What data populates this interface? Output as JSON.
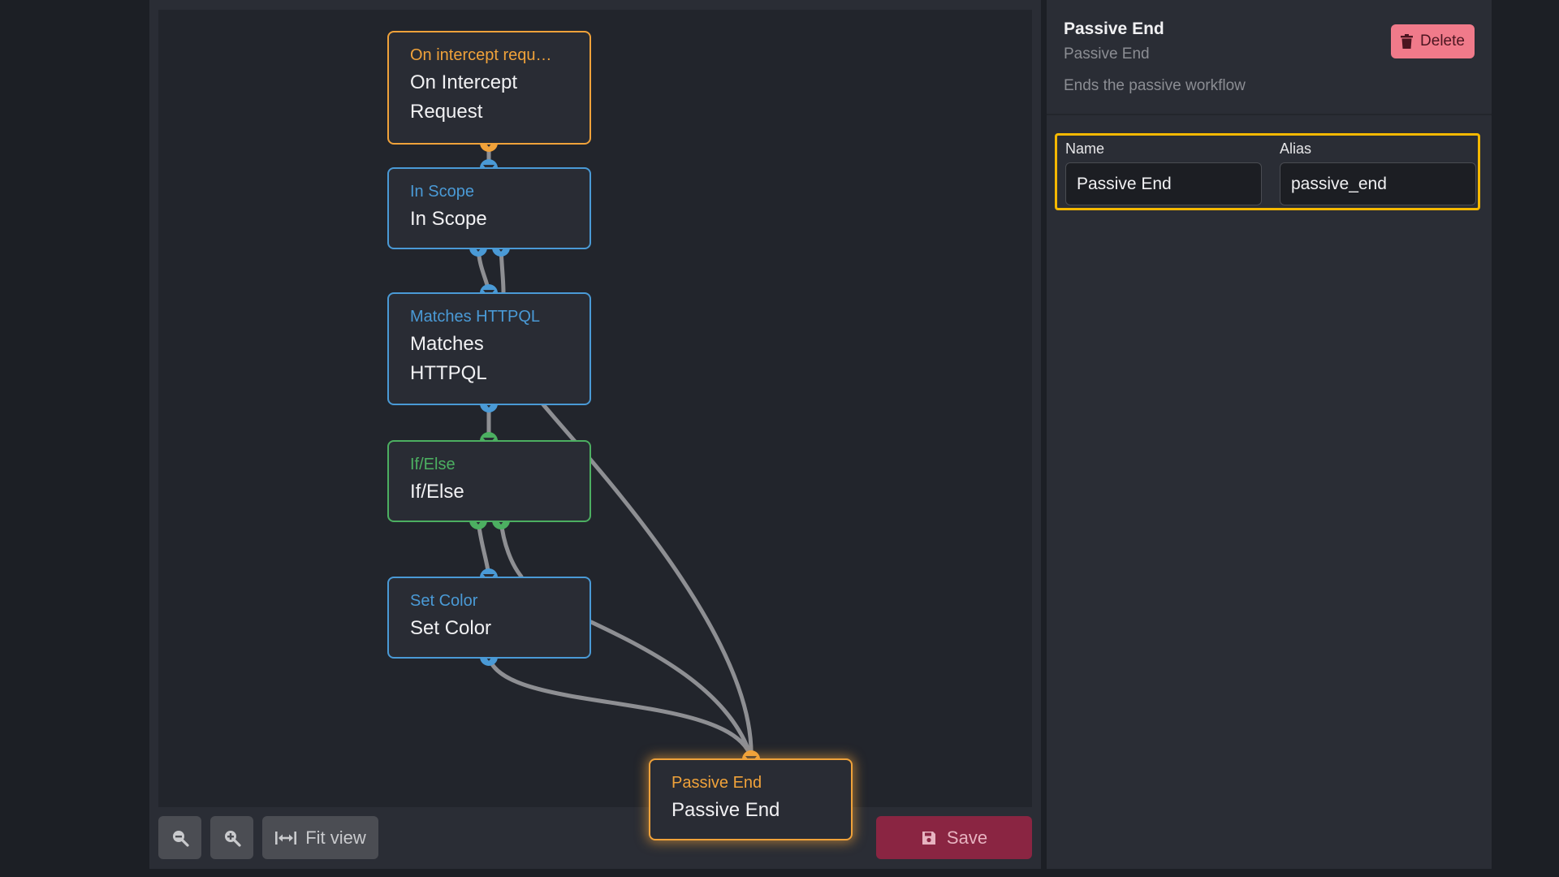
{
  "canvas": {
    "nodes": [
      {
        "id": "on_intercept",
        "type_label": "On intercept requ…",
        "name": "On Intercept Request",
        "color": "#f0a23a"
      },
      {
        "id": "in_scope",
        "type_label": "In Scope",
        "name": "In Scope",
        "color": "#4a9ad6"
      },
      {
        "id": "matches_httpql",
        "type_label": "Matches HTTPQL",
        "name": "Matches HTTPQL",
        "color": "#4a9ad6"
      },
      {
        "id": "if_else",
        "type_label": "If/Else",
        "name": "If/Else",
        "color": "#4caf61"
      },
      {
        "id": "set_color",
        "type_label": "Set Color",
        "name": "Set Color",
        "color": "#4a9ad6"
      },
      {
        "id": "passive_end",
        "type_label": "Passive End",
        "name": "Passive End",
        "color": "#f0a23a",
        "selected": true
      }
    ],
    "edge_color": "#8e8f93"
  },
  "toolbar": {
    "zoom_out_icon": "zoom-out-icon",
    "zoom_in_icon": "zoom-in-icon",
    "fit_view_label": "Fit view",
    "save_label": "Save"
  },
  "inspector": {
    "title": "Passive End",
    "subtitle": "Passive End",
    "description": "Ends the passive workflow",
    "delete_label": "Delete",
    "fields": {
      "name_label": "Name",
      "name_value": "Passive End",
      "alias_label": "Alias",
      "alias_value": "passive_end"
    }
  },
  "colors": {
    "accent_highlight": "#f5b800",
    "delete_bg": "#f07a8a",
    "save_bg": "#8a2542"
  }
}
